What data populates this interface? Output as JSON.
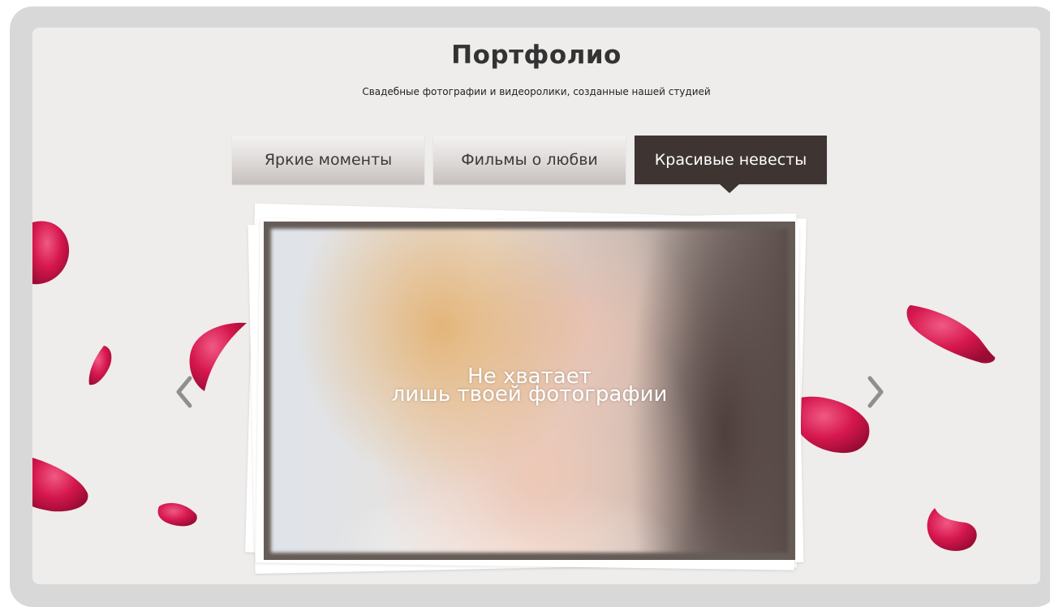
{
  "section": {
    "title": "Портфолио",
    "subtitle": "Свадебные фотографии и видеоролики, созданные нашей студией"
  },
  "tabs": [
    {
      "label": "Яркие моменты",
      "active": false
    },
    {
      "label": "Фильмы о любви",
      "active": false
    },
    {
      "label": "Красивые невесты",
      "active": true
    }
  ],
  "slide": {
    "caption_line1": "Не хватает",
    "caption_line2": "лишь твоей фотографии"
  },
  "icons": {
    "prev": "chevron-left-icon",
    "next": "chevron-right-icon"
  },
  "colors": {
    "active_tab": "#3e3533",
    "panel": "#efedeb",
    "petal": "#d6174e"
  }
}
